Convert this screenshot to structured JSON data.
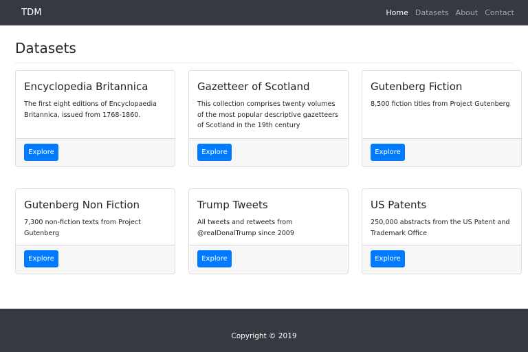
{
  "navbar": {
    "brand": "TDM",
    "links": [
      {
        "label": "Home",
        "active": true
      },
      {
        "label": "Datasets",
        "active": false
      },
      {
        "label": "About",
        "active": false
      },
      {
        "label": "Contact",
        "active": false
      }
    ]
  },
  "main": {
    "title": "Datasets",
    "cards": [
      {
        "title": "Encyclopedia Britannica",
        "text": "The first eight editions of Encyclopaedia Britannica, issued from 1768-1860.",
        "button": "Explore"
      },
      {
        "title": "Gazetteer of Scotland",
        "text": "This collection comprises twenty volumes of the most popular descriptive gazetteers of Scotland in the 19th century",
        "button": "Explore"
      },
      {
        "title": "Gutenberg Fiction",
        "text": "8,500 fiction titles from Project Gutenberg",
        "button": "Explore"
      },
      {
        "title": "Gutenberg Non Fiction",
        "text": "7,300 non-fiction texts from Project Gutenberg",
        "button": "Explore"
      },
      {
        "title": "Trump Tweets",
        "text": "All tweets and retweets from @realDonalTrump since 2009",
        "button": "Explore"
      },
      {
        "title": "US Patents",
        "text": "250,000 abstracts from the US Patent and Trademark Office",
        "button": "Explore"
      }
    ]
  },
  "footer": {
    "copyright": "Copyright © 2019"
  },
  "colors": {
    "navbar": "#343a40",
    "primary": "#007bff",
    "card_footer": "#f7f7f7"
  }
}
